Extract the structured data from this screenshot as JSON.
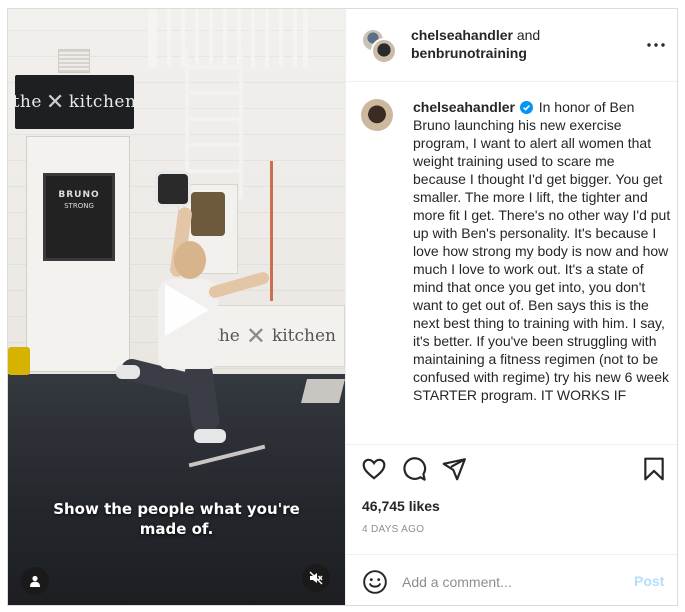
{
  "video": {
    "wall_sign_text": "the",
    "wall_sign_text2": "kitchen",
    "chalk_title": "BRUNO",
    "chalk_sub": "STRONG",
    "floor_sign_text": "the",
    "floor_sign_text2": "kitchen",
    "caption_line1": "Show the people what you're",
    "caption_line2": "made of."
  },
  "header": {
    "author1": "chelseahandler",
    "joiner": " and",
    "author2": "benbrunotraining"
  },
  "post": {
    "username": "chelseahandler",
    "caption": "In honor of Ben Bruno launching his new exercise program, I want to alert all women that weight training used to scare me because I thought I'd get bigger. You get smaller. The more I lift, the tighter and more fit I get. There's no other way I'd put up with Ben's personality. It's because I love how strong my body is now and how much I love to work out. It's a state of mind that once you get into, you don't want to get out of. Ben says this is the next best thing to training with him. I say, it's better. If you've been struggling with maintaining a fitness regimen (not to be confused with regime) try his new 6 week STARTER program. IT WORKS IF",
    "likes": "46,745 likes",
    "date": "4 DAYS AGO"
  },
  "comment": {
    "placeholder": "Add a comment...",
    "post_label": "Post"
  },
  "colors": {
    "verified": "#0095f6",
    "post_disabled": "#b2dffc",
    "border": "#dbdbdb"
  },
  "icons": [
    "heart-icon",
    "comment-icon",
    "share-icon",
    "bookmark-icon",
    "emoji-icon",
    "more-icon",
    "play-icon",
    "user-icon",
    "mute-icon",
    "verified-icon"
  ]
}
